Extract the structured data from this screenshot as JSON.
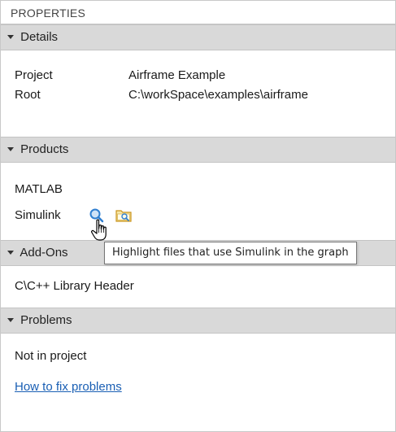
{
  "panel": {
    "title": "PROPERTIES"
  },
  "details": {
    "header": "Details",
    "rows": [
      {
        "key": "Project",
        "value": "Airframe Example"
      },
      {
        "key": "Root",
        "value": "C:\\workSpace\\examples\\airframe"
      }
    ]
  },
  "products": {
    "header": "Products",
    "items": [
      "MATLAB",
      "Simulink"
    ],
    "icons": [
      "highlight-magnifier-icon",
      "folder-search-icon"
    ]
  },
  "addons": {
    "header": "Add-Ons",
    "items": [
      "C\\C++ Library Header"
    ]
  },
  "problems": {
    "header": "Problems",
    "status": "Not in project",
    "link": "How to fix problems"
  },
  "tooltip": {
    "text": "Highlight files that use Simulink in the graph"
  },
  "colors": {
    "section_header_bg": "#d9d9d9",
    "link": "#1a5fb4",
    "icon_blue": "#2f7fd0",
    "icon_folder": "#e0b03a"
  }
}
